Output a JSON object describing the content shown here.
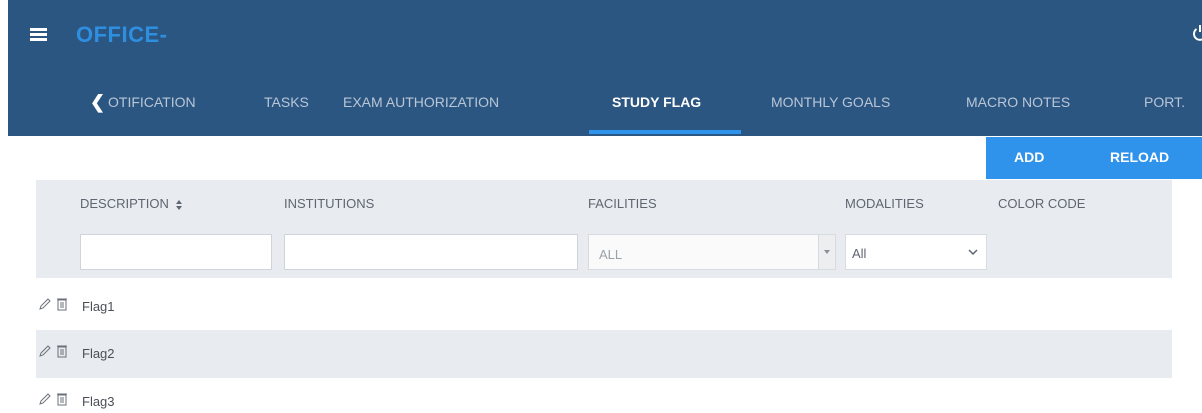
{
  "header": {
    "app_title": "OFFICE-",
    "menu_icon": "hamburger-icon",
    "power_icon": "power-icon"
  },
  "tabs": [
    {
      "label": "OTIFICATION"
    },
    {
      "label": "TASKS"
    },
    {
      "label": "EXAM AUTHORIZATION"
    },
    {
      "label": "STUDY FLAG",
      "active": true
    },
    {
      "label": "MONTHLY GOALS"
    },
    {
      "label": "MACRO NOTES"
    },
    {
      "label": "PORT."
    }
  ],
  "actions": {
    "add_label": "ADD",
    "reload_label": "RELOAD"
  },
  "grid": {
    "columns": {
      "description": "DESCRIPTION",
      "institutions": "INSTITUTIONS",
      "facilities": "FACILITIES",
      "modalities": "MODALITIES",
      "color_code": "COLOR CODE"
    },
    "filters": {
      "facilities_value": "ALL",
      "modalities_value": "All"
    },
    "rows": [
      {
        "description": "Flag1"
      },
      {
        "description": "Flag2"
      },
      {
        "description": "Flag3"
      }
    ]
  },
  "colors": {
    "topbar": "#2c5682",
    "accent": "#2f93ec",
    "grid_header": "#e8ebef"
  }
}
